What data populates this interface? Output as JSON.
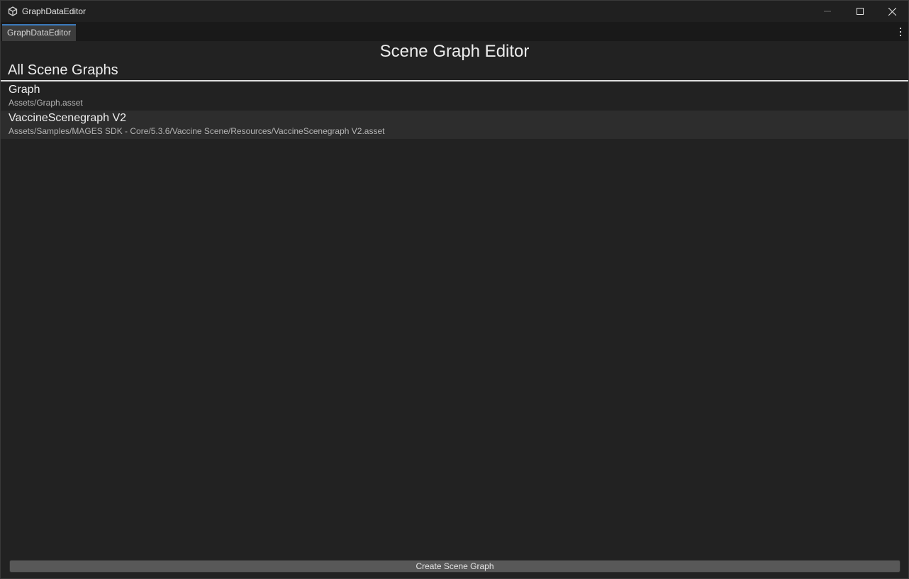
{
  "window": {
    "title": "GraphDataEditor",
    "icons": [
      "unity-app-icon",
      "minimize-icon",
      "maximize-icon",
      "close-icon"
    ]
  },
  "tabs": [
    {
      "label": "GraphDataEditor",
      "active": true
    }
  ],
  "tab_menu_icon": "kebab-menu-icon",
  "editor": {
    "title": "Scene Graph Editor",
    "section_title": "All Scene Graphs",
    "graphs": [
      {
        "name": "Graph",
        "path": "Assets/Graph.asset"
      },
      {
        "name": "VaccineScenegraph V2",
        "path": "Assets/Samples/MAGES SDK - Core/5.3.6/Vaccine Scene/Resources/VaccineScenegraph V2.asset"
      }
    ],
    "create_button_label": "Create Scene Graph"
  },
  "colors": {
    "background": "#222222",
    "titlebar": "#202020",
    "tab_accent": "#3a79bb",
    "row_alt": "#2d2d2d",
    "button": "#585858"
  }
}
